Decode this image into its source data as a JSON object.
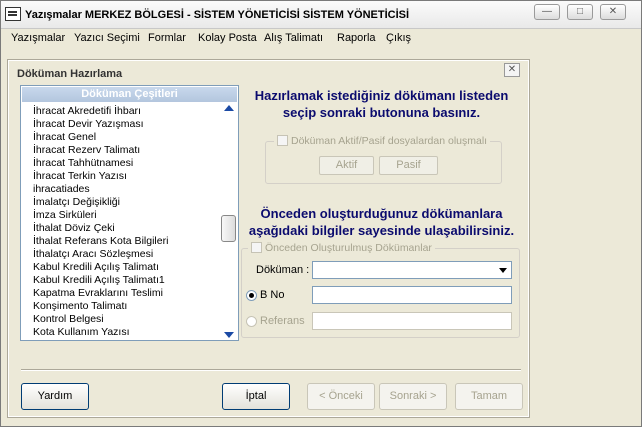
{
  "window": {
    "title": "Yazışmalar MERKEZ BÖLGESİ - SİSTEM YÖNETİCİSİ SİSTEM YÖNETİCİSİ",
    "controls": {
      "minimize": "—",
      "maximize": "□",
      "close": "✕"
    }
  },
  "menu": [
    "Yazışmalar",
    "Yazıcı Seçimi",
    "Formlar",
    "Kolay Posta",
    "Alış Talimatı",
    "Raporla",
    "Çıkış"
  ],
  "dialog": {
    "title": "Döküman Hazırlama",
    "close": "✕",
    "list": {
      "header": "Döküman Çeşitleri",
      "items": [
        "İhracat Akredetifi İhbarı",
        "İhracat Devir Yazışması",
        "İhracat Genel",
        "İhracat Rezerv Talimatı",
        "İhracat Tahhütnamesi",
        "İhracat Terkin Yazısı",
        "ihracatiades",
        "İmalatçı Değişikliği",
        "İmza Sirküleri",
        "İthalat Döviz Çeki",
        "İthalat Referans Kota Bilgileri",
        "İthalatçı Aracı Sözleşmesi",
        "Kabul Kredili Açılış Talimatı",
        "Kabul Kredili Açılış Talimatı1",
        "Kapatma Evraklarını Teslimi",
        "Konşimento Talimatı",
        "Kontrol Belgesi",
        "Kota Kullanım Yazısı"
      ]
    },
    "instruction1": "Hazırlamak istediğiniz dökümanı listeden seçip sonraki butonuna basınız.",
    "group1": {
      "label": "Döküman Aktif/Pasif dosyalardan oluşmalı",
      "aktif": "Aktif",
      "pasif": "Pasif"
    },
    "instruction2": "Önceden oluşturduğunuz dökümanlara aşağıdaki bilgiler sayesinde ulaşabilirsiniz.",
    "group2": {
      "label": "Önceden Oluşturulmuş Dökümanlar",
      "dokuman_label": "Döküman :",
      "dokuman_value": "",
      "bno_label": "B No",
      "bno_value": "",
      "referans_label": "Referans",
      "referans_value": ""
    },
    "buttons": {
      "yardim": "Yardım",
      "iptal": "İptal",
      "onceki": "< Önceki",
      "sonraki": "Sonraki >",
      "tamam": "Tamam"
    }
  }
}
